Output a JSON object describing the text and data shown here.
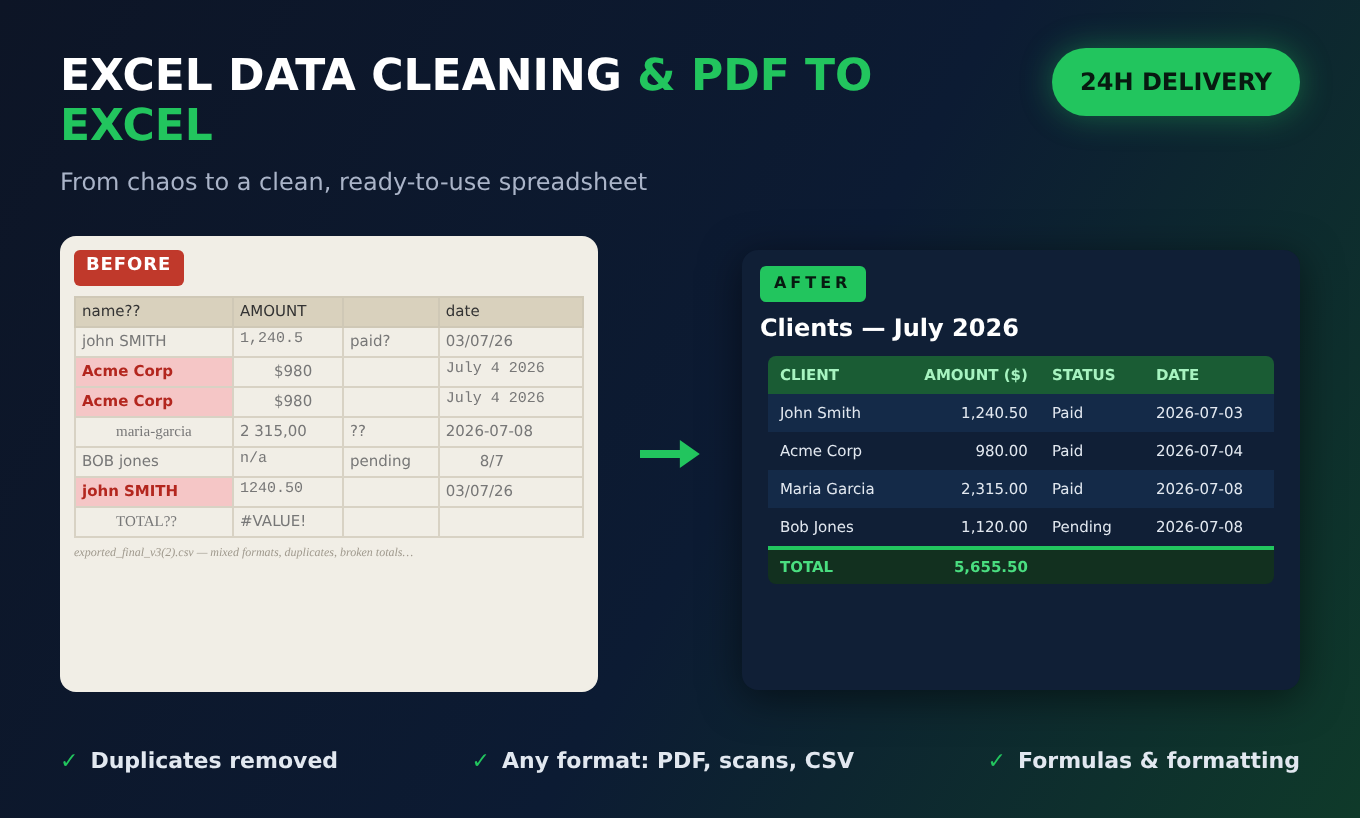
{
  "header": {
    "title_main": "EXCEL DATA CLEANING",
    "title_accent": "& PDF TO EXCEL",
    "subtitle": "From chaos to a clean, ready-to-use spreadsheet",
    "badge": "24H DELIVERY"
  },
  "before": {
    "label": "BEFORE",
    "columns": [
      "name??",
      "AMOUNT",
      "",
      "date"
    ],
    "rows": [
      {
        "duplicate": false,
        "cells": [
          {
            "text": "john SMITH",
            "kind": "plain"
          },
          {
            "text": "1,240.5",
            "kind": "mono"
          },
          {
            "text": "paid?",
            "kind": "plain"
          },
          {
            "text": "03/07/26",
            "kind": "plain"
          }
        ]
      },
      {
        "duplicate": true,
        "cells": [
          {
            "text": "Acme Corp",
            "kind": "plain"
          },
          {
            "text": "$980",
            "kind": "indent"
          },
          {
            "text": "",
            "kind": "plain"
          },
          {
            "text": "July 4 2026",
            "kind": "mono"
          }
        ]
      },
      {
        "duplicate": true,
        "cells": [
          {
            "text": "Acme Corp",
            "kind": "plain"
          },
          {
            "text": "$980",
            "kind": "indent"
          },
          {
            "text": "",
            "kind": "plain"
          },
          {
            "text": "July 4 2026",
            "kind": "mono"
          }
        ]
      },
      {
        "duplicate": false,
        "cells": [
          {
            "text": "maria-garcia",
            "kind": "serif"
          },
          {
            "text": "2 315,00",
            "kind": "plain"
          },
          {
            "text": "??",
            "kind": "plain"
          },
          {
            "text": "2026-07-08",
            "kind": "plain"
          }
        ]
      },
      {
        "duplicate": false,
        "cells": [
          {
            "text": "BOB jones",
            "kind": "plain"
          },
          {
            "text": "n/a",
            "kind": "mono"
          },
          {
            "text": "pending",
            "kind": "plain"
          },
          {
            "text": "8/7",
            "kind": "indent"
          }
        ]
      },
      {
        "duplicate": true,
        "cells": [
          {
            "text": "john SMITH",
            "kind": "plain"
          },
          {
            "text": "1240.50",
            "kind": "mono"
          },
          {
            "text": "",
            "kind": "plain"
          },
          {
            "text": "03/07/26",
            "kind": "plain"
          }
        ]
      },
      {
        "duplicate": false,
        "cells": [
          {
            "text": "TOTAL??",
            "kind": "serif"
          },
          {
            "text": "#VALUE!",
            "kind": "plain"
          },
          {
            "text": "",
            "kind": "plain"
          },
          {
            "text": "",
            "kind": "plain"
          }
        ]
      }
    ],
    "caption": "exported_final_v3(2).csv — mixed formats, duplicates, broken totals…"
  },
  "after": {
    "label": "AFTER",
    "title": "Clients — July 2026",
    "columns": [
      "CLIENT",
      "AMOUNT ($)",
      "STATUS",
      "DATE"
    ],
    "rows": [
      [
        "John Smith",
        "1,240.50",
        "Paid",
        "2026-07-03"
      ],
      [
        "Acme Corp",
        "980.00",
        "Paid",
        "2026-07-04"
      ],
      [
        "Maria Garcia",
        "2,315.00",
        "Paid",
        "2026-07-08"
      ],
      [
        "Bob Jones",
        "1,120.00",
        "Pending",
        "2026-07-08"
      ]
    ],
    "total": {
      "label": "TOTAL",
      "amount": "5,655.50"
    }
  },
  "features": [
    {
      "check": "✓",
      "text": "Duplicates removed"
    },
    {
      "check": "✓",
      "text": "Any format: PDF, scans, CSV"
    },
    {
      "check": "✓",
      "text": "Formulas & formatting"
    }
  ]
}
